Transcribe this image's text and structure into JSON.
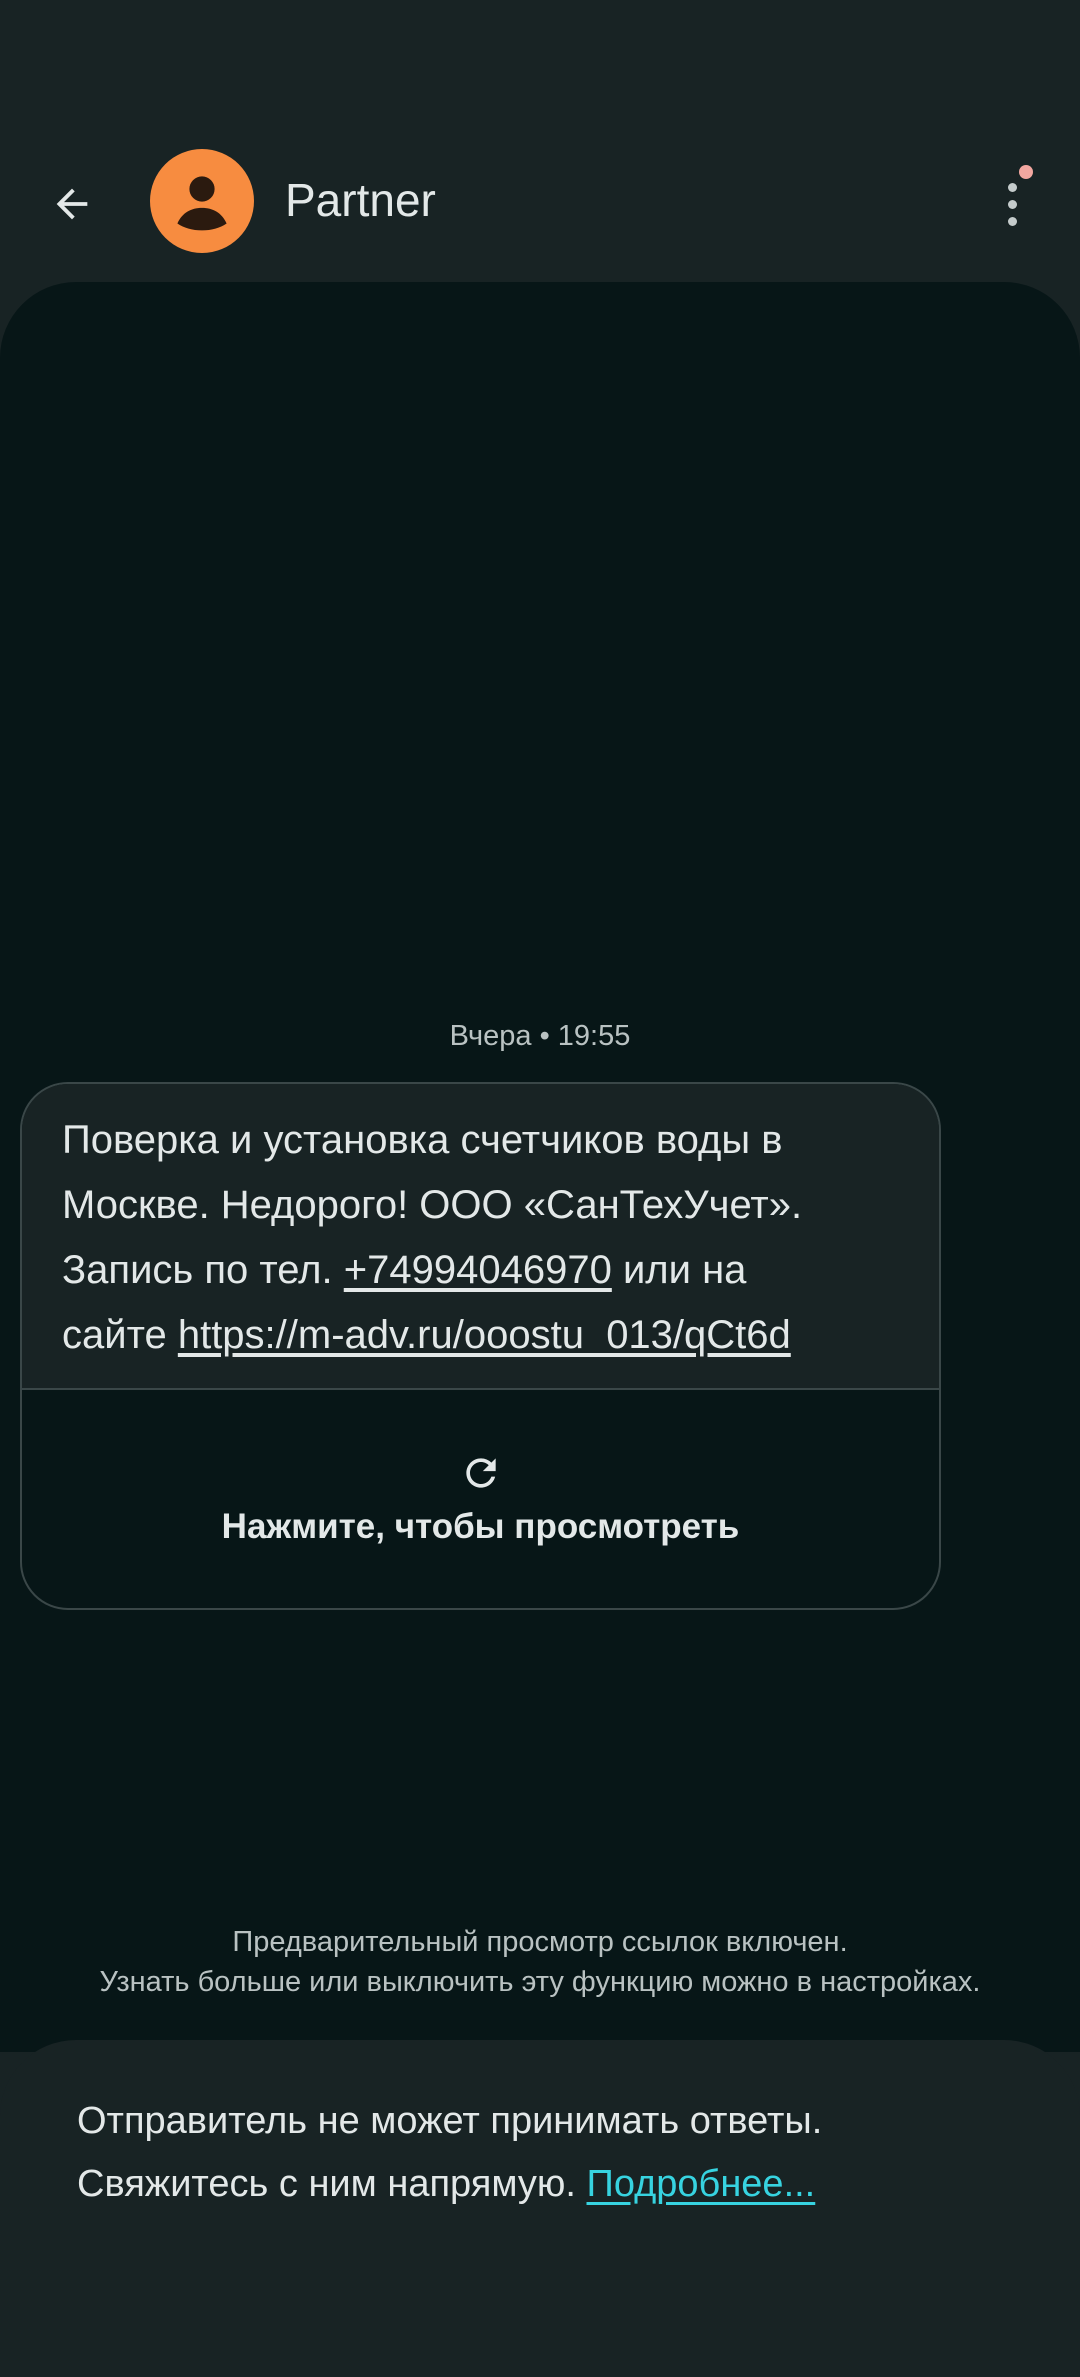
{
  "header": {
    "contact_name": "Partner",
    "avatar_color": "#f78c40",
    "back_icon": "arrow-left",
    "more_icon": "more-vert"
  },
  "conversation": {
    "timestamp": "Вчера • 19:55",
    "message": {
      "line1": "Поверка и установка счетчиков воды в",
      "line2": "Москве. Недорого! ООО «СанТехУчет».",
      "line3_prefix": "Запись по тел. ",
      "phone": "+74994046970",
      "line3_suffix": " или на",
      "line4_prefix": "сайте ",
      "url": "https://m-adv.ru/ooostu_013/qCt6d"
    },
    "preview": {
      "label": "Нажмите, чтобы просмотреть",
      "icon": "refresh"
    },
    "info_line1": "Предварительный просмотр ссылок включен.",
    "info_line2": "Узнать больше или выключить эту функцию можно в настройках."
  },
  "footer": {
    "line1": "Отправитель не может принимать ответы.",
    "line2": "Свяжитесь с ним напрямую. ",
    "learn_more": "Подробнее..."
  },
  "colors": {
    "background": "#182324",
    "conversation_bg": "#071617",
    "link_accent": "#37d3e0",
    "notification_dot": "#f2a7a0"
  }
}
